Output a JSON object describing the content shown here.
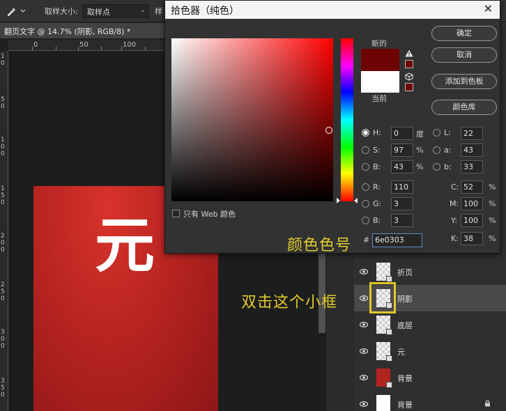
{
  "options_bar": {
    "sample_size_label": "取样大小:",
    "sample_size_value": "取样点",
    "sample_label_cut": "样"
  },
  "document": {
    "tab_title": "翻页文字 @ 14.7% (阴影, RGB/8) *",
    "ruler_h": [
      "0",
      "50",
      "100"
    ],
    "ruler_v": [
      "1",
      "0",
      "5",
      "0",
      "1",
      "0",
      "0",
      "1",
      "5",
      "0",
      "2",
      "0",
      "0",
      "2",
      "5",
      "0",
      "3",
      "0",
      "0",
      "3",
      "5",
      "0"
    ],
    "canvas_text": "元"
  },
  "color_picker": {
    "title": "拾色器（纯色）",
    "new_label": "新的",
    "current_label": "当前",
    "new_color": "#6e0303",
    "current_color": "#ffffff",
    "buttons": {
      "ok": "确定",
      "cancel": "取消",
      "add_swatch": "添加到色板",
      "color_library": "颜色库"
    },
    "hsb": {
      "h_label": "H:",
      "h_value": "0",
      "h_unit": "度",
      "s_label": "S:",
      "s_value": "97",
      "s_unit": "%",
      "b_label": "B:",
      "b_value": "43",
      "b_unit": "%"
    },
    "rgb": {
      "r_label": "R:",
      "r_value": "110",
      "g_label": "G:",
      "g_value": "3",
      "b_label": "B:",
      "b_value": "3"
    },
    "lab": {
      "l_label": "L:",
      "l_value": "22",
      "a_label": "a:",
      "a_value": "43",
      "b_label": "b:",
      "b_value": "33"
    },
    "cmyk": {
      "c_label": "C:",
      "c_value": "52",
      "m_label": "M:",
      "m_value": "100",
      "y_label": "Y:",
      "y_value": "100",
      "k_label": "K:",
      "k_value": "38",
      "unit": "%"
    },
    "hex_hash": "#",
    "hex_value": "6e0303",
    "web_only_label": "只有 Web 颜色"
  },
  "annotations": {
    "hex_note": "颜色色号",
    "double_click_note": "双击这个小框"
  },
  "layers": [
    {
      "name": "折页",
      "thumb": "checker"
    },
    {
      "name": "阴影",
      "thumb": "checker",
      "selected": true
    },
    {
      "name": "底层",
      "thumb": "checker"
    },
    {
      "name": "元",
      "thumb": "checker"
    },
    {
      "name": "背景",
      "thumb": "red"
    },
    {
      "name": "背景",
      "thumb": "white",
      "locked": true
    }
  ],
  "colors": {
    "accent_annotation": "#e2cc2e",
    "card_red": "#b82420"
  }
}
